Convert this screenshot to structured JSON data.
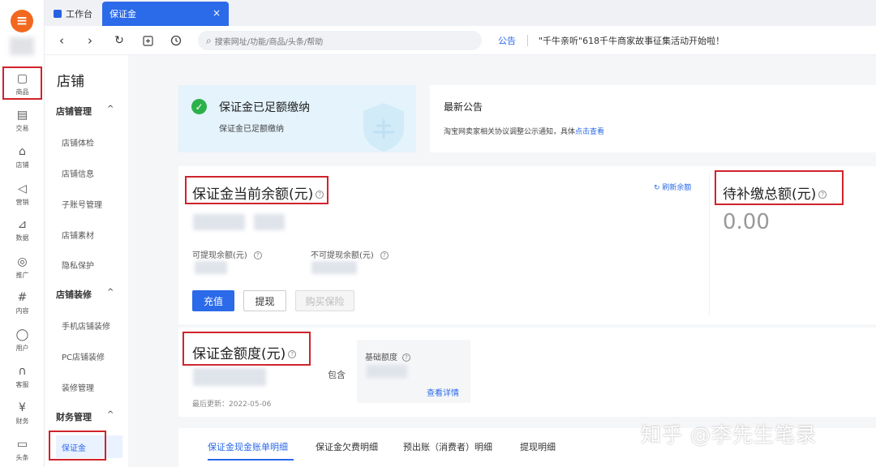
{
  "browser": {
    "tabs": [
      {
        "label": "工作台"
      },
      {
        "label": "保证金",
        "close": "×"
      }
    ],
    "search_placeholder": "搜索网址/功能/商品/头条/帮助",
    "notice_label": "公告",
    "notice_text": "\"千牛亲听\"618千牛商家故事征集活动开始啦！"
  },
  "rail": {
    "items": [
      {
        "label": "商品",
        "icon": "bag-icon",
        "selected": true
      },
      {
        "label": "交易",
        "icon": "order-icon"
      },
      {
        "label": "店铺",
        "icon": "store-icon"
      },
      {
        "label": "营销",
        "icon": "megaphone-icon"
      },
      {
        "label": "数据",
        "icon": "chart-icon"
      },
      {
        "label": "推广",
        "icon": "location-icon"
      },
      {
        "label": "内容",
        "icon": "hash-icon"
      },
      {
        "label": "用户",
        "icon": "user-icon"
      },
      {
        "label": "客服",
        "icon": "headset-icon"
      },
      {
        "label": "财务",
        "icon": "yen-icon"
      },
      {
        "label": "头条",
        "icon": "news-icon"
      }
    ]
  },
  "sidebar": {
    "title": "店铺",
    "groups": [
      {
        "label": "店铺管理",
        "items": [
          "店铺体检",
          "店铺信息",
          "子账号管理",
          "店铺素材",
          "隐私保护"
        ]
      },
      {
        "label": "店铺装修",
        "items": [
          "手机店铺装修",
          "PC店铺装修",
          "装修管理"
        ]
      },
      {
        "label": "财务管理",
        "items": [
          "保证金"
        ]
      }
    ],
    "active_item": "保证金"
  },
  "status": {
    "title": "保证金已足额缴纳",
    "subtitle": "保证金已足额缴纳"
  },
  "announcement": {
    "title": "最新公告",
    "text": "淘宝网卖家相关协议调整公示通知，具体",
    "link": "点击查看"
  },
  "balance": {
    "title": "保证金当前余额(元)",
    "refresh": "刷新余额",
    "withdrawable_label": "可提现余额(元)",
    "non_withdrawable_label": "不可提现余额(元)",
    "buttons": {
      "recharge": "充值",
      "withdraw": "提现",
      "insurance": "购买保险"
    }
  },
  "pending": {
    "title": "待补缴总额(元)",
    "amount": "0.00"
  },
  "quota": {
    "title": "保证金额度(元)",
    "includes": "包含",
    "base_label": "基础额度",
    "details_link": "查看详情",
    "last_updated": "最后更新：2022-05-06"
  },
  "tabs": [
    "保证金现金账单明细",
    "保证金欠费明细",
    "预出账（消费者）明细",
    "提现明细"
  ],
  "watermark": "知乎 @李先生笔录",
  "colors": {
    "accent": "#2b6ae9",
    "highlight_box": "#d0232b",
    "success": "#2cb14a",
    "brand": "#f2681e"
  }
}
